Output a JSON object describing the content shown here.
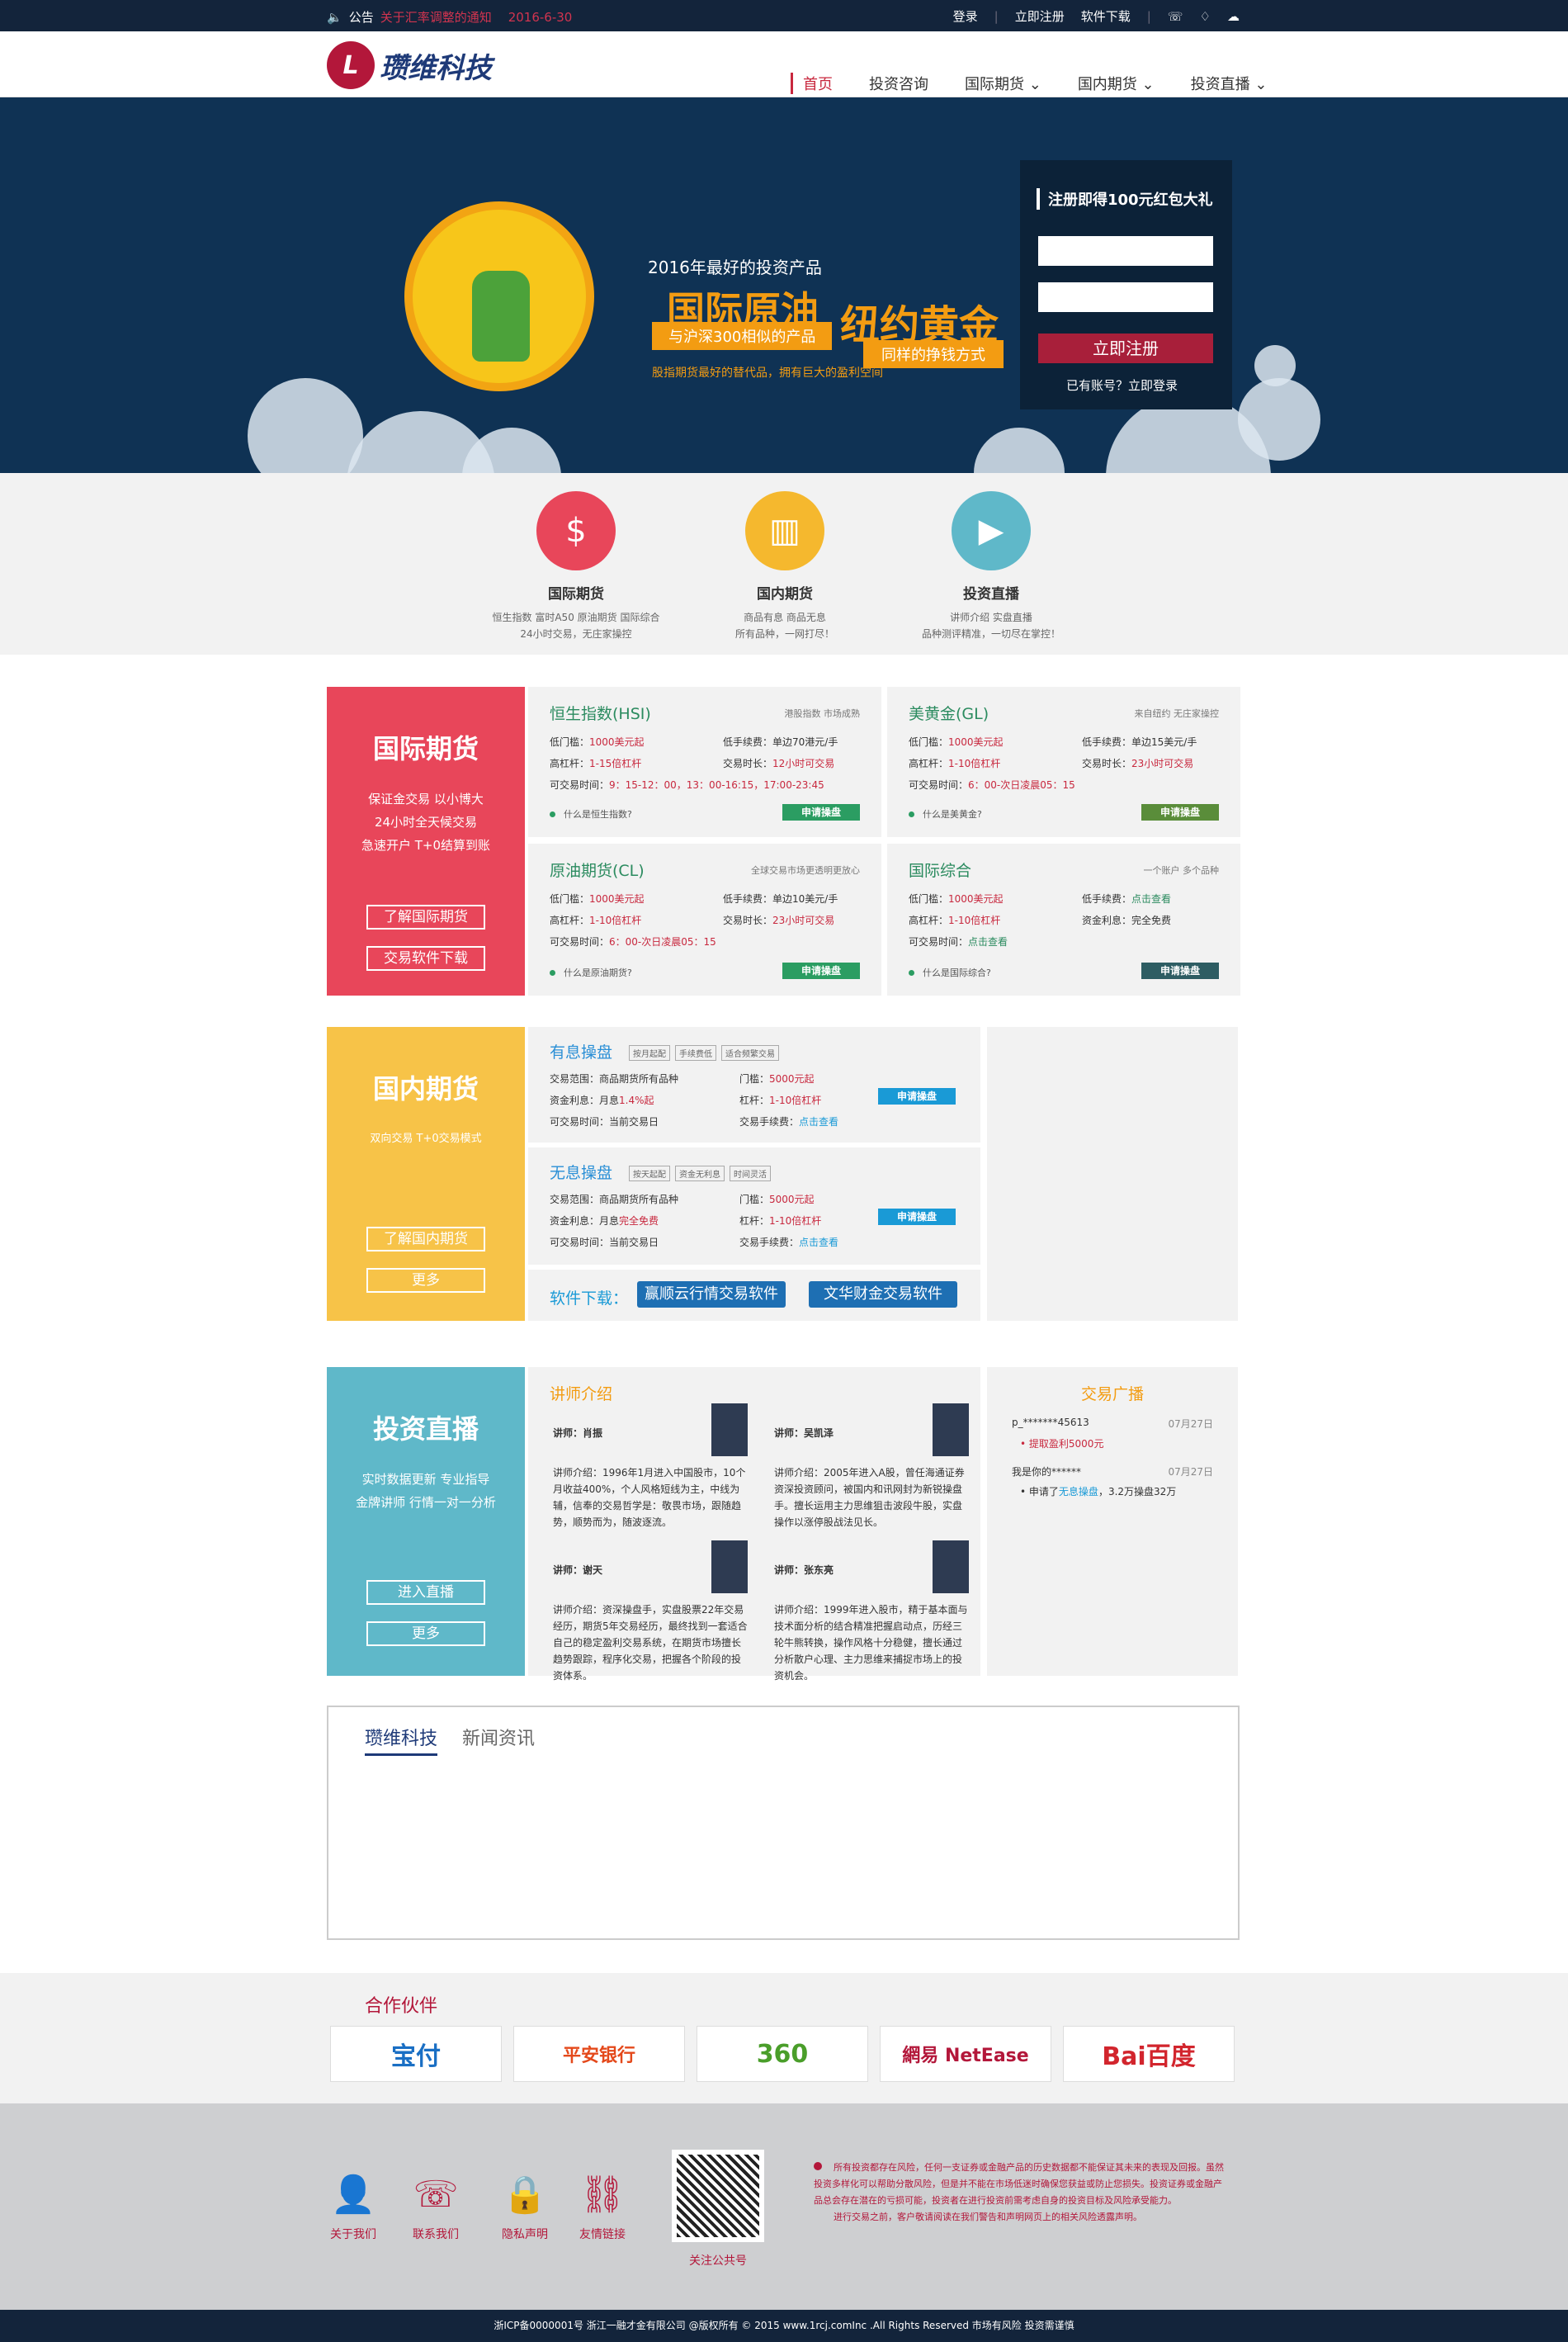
{
  "topbar": {
    "notice_label": "公告",
    "notice_text": "关于汇率调整的通知",
    "notice_date": "2016-6-30",
    "login": "登录",
    "register": "立即注册",
    "download": "软件下载"
  },
  "header": {
    "logo_mark": "L",
    "logo_name": "瓒维科技",
    "nav": [
      "首页",
      "投资咨询",
      "国际期货",
      "国内期货",
      "投资直播"
    ]
  },
  "banner": {
    "line1": "2016年最好的投资产品",
    "line2": "国际原油",
    "line3": "与沪深300相似的产品",
    "line4": "纽约黄金",
    "line5": "同样的挣钱方式",
    "line6": "股指期货最好的替代品，拥有巨大的盈利空间",
    "reg_title": "注册即得100元红包大礼",
    "reg_button": "立即注册",
    "reg_login": "已有账号？立即登录"
  },
  "features": [
    {
      "title": "国际期货",
      "desc1": "恒生指数 富时A50 原油期货 国际综合",
      "desc2": "24小时交易，无庄家操控",
      "color": "#e8465a"
    },
    {
      "title": "国内期货",
      "desc1": "商品有息 商品无息",
      "desc2": "所有品种，一网打尽！",
      "color": "#f5b82e"
    },
    {
      "title": "投资直播",
      "desc1": "讲师介绍 实盘直播",
      "desc2": "品种测评精准，一切尽在掌控！",
      "color": "#5fb8c9"
    }
  ],
  "intl": {
    "title": "国际期货",
    "desc": [
      "保证金交易  以小博大",
      "24小时全天候交易",
      "急速开户  T+0结算到账"
    ],
    "btn1": "了解国际期货",
    "btn2": "交易软件下载",
    "cards": [
      {
        "title": "恒生指数(HSI)",
        "sub": "港股指数 市场成熟",
        "r1a": "低门槛：",
        "r1b": "1000美元起",
        "r1c": "低手续费：",
        "r1d": "单边70港元/手",
        "r2a": "高杠杆：",
        "r2b": "1-15倍杠杆",
        "r2c": "交易时长：",
        "r2d": "12小时可交易",
        "r3a": "可交易时间：",
        "r3b": "9：15-12：00，13：00-16:15，17:00-23:45",
        "q": "什么是恒生指数?",
        "apply": "申请操盘"
      },
      {
        "title": "美黄金(GL)",
        "sub": "来自纽约 无庄家操控",
        "r1a": "低门槛：",
        "r1b": "1000美元起",
        "r1c": "低手续费：",
        "r1d": "单边15美元/手",
        "r2a": "高杠杆：",
        "r2b": "1-10倍杠杆",
        "r2c": "交易时长：",
        "r2d": "23小时可交易",
        "r3a": "可交易时间：",
        "r3b": "6：00-次日凌晨05：15",
        "q": "什么是美黄金?",
        "apply": "申请操盘"
      },
      {
        "title": "原油期货(CL)",
        "sub": "全球交易市场更透明更放心",
        "r1a": "低门槛：",
        "r1b": "1000美元起",
        "r1c": "低手续费：",
        "r1d": "单边10美元/手",
        "r2a": "高杠杆：",
        "r2b": "1-10倍杠杆",
        "r2c": "交易时长：",
        "r2d": "23小时可交易",
        "r3a": "可交易时间：",
        "r3b": "6：00-次日凌晨05：15",
        "q": "什么是原油期货?",
        "apply": "申请操盘"
      },
      {
        "title": "国际综合",
        "sub": "一个账户 多个品种",
        "r1a": "低门槛：",
        "r1b": "1000美元起",
        "r1c": "低手续费：",
        "r1d": "点击查看",
        "r2a": "高杠杆：",
        "r2b": "1-10倍杠杆",
        "r2c": "资金利息：",
        "r2d": "完全免费",
        "r3a": "可交易时间：",
        "r3b": "点击查看",
        "q": "什么是国际综合?",
        "apply": "申请操盘"
      }
    ]
  },
  "domestic": {
    "title": "国内期货",
    "desc": "双向交易 T+0交易模式",
    "btn1": "了解国内期货",
    "btn2": "更多",
    "cards": [
      {
        "title": "有息操盘",
        "tags": [
          "按月起配",
          "手续费低",
          "适合频繁交易"
        ],
        "a1": "交易范围：商品期货所有品种",
        "a2": "门槛：",
        "a2v": "5000元起",
        "b1": "资金利息：月息",
        "b1v": "1.4%起",
        "b2": "杠杆：",
        "b2v": "1-10倍杠杆",
        "c1": "可交易时间：当前交易日",
        "c2": "交易手续费：",
        "c2v": "点击查看",
        "apply": "申请操盘"
      },
      {
        "title": "无息操盘",
        "tags": [
          "按天起配",
          "资金无利息",
          "时间灵活"
        ],
        "a1": "交易范围：商品期货所有品种",
        "a2": "门槛：",
        "a2v": "5000元起",
        "b1": "资金利息：月息",
        "b1v": "完全免费",
        "b2": "杠杆：",
        "b2v": "1-10倍杠杆",
        "c1": "可交易时间：当前交易日",
        "c2": "交易手续费：",
        "c2v": "点击查看",
        "apply": "申请操盘"
      }
    ],
    "sw_label": "软件下载：",
    "sw1": "赢顺云行情交易软件",
    "sw2": "文华财金交易软件"
  },
  "live": {
    "title": "投资直播",
    "desc": [
      "实时数据更新  专业指导",
      "金牌讲师  行情一对一分析"
    ],
    "btn1": "进入直播",
    "btn2": "更多",
    "teachers_title": "讲师介绍",
    "teachers": [
      {
        "name": "讲师：肖振",
        "bio": "讲师介绍：1996年1月进入中国股市，10个月收益400%，个人风格短线为主，中线为辅，信奉的交易哲学是：敬畏市场，跟随趋势，顺势而为，随波逐流。"
      },
      {
        "name": "讲师：吴凯泽",
        "bio": "讲师介绍：2005年进入A股，曾任海通证券资深投资顾问，被国内和讯网封为新锐操盘手。擅长运用主力思维狙击波段牛股，实盘操作以涨停股战法见长。"
      },
      {
        "name": "讲师：谢天",
        "bio": "讲师介绍：资深操盘手，实盘股票22年交易经历，期货5年交易经历，最终找到一套适合自己的稳定盈利交易系统，在期货市场擅长趋势跟踪，程序化交易，把握各个阶段的投资体系。"
      },
      {
        "name": "讲师：张东亮",
        "bio": "讲师介绍：1999年进入股市，精于基本面与技术面分析的结合精准把握启动点，历经三轮牛熊转换，操作风格十分稳健，擅长通过分析散户心理、主力思维来捕捉市场上的投资机会。"
      }
    ],
    "bcast_title": "交易广播",
    "bcast": [
      {
        "user": "p_*******45613",
        "date": "07月27日",
        "text": "提取盈利5000元"
      },
      {
        "user": "我是你的******",
        "date": "07月27日",
        "text_a": "申请了",
        "text_b": "无息操盘",
        "text_c": "，3.2万操盘32万"
      }
    ]
  },
  "news": {
    "tab1": "瓒维科技",
    "tab2": "新闻资讯"
  },
  "partners": {
    "title": "合作伙伴",
    "logos": [
      "宝付",
      "平安银行",
      "360",
      "網易 NetEase",
      "Bai百度"
    ],
    "logo_colors": [
      "#1a6fc4",
      "#e4491b",
      "#4a9e2a",
      "#b3173a",
      "#d2252d"
    ]
  },
  "footer": {
    "items": [
      "关于我们",
      "联系我们",
      "隐私声明",
      "友情链接"
    ],
    "qr_label": "关注公共号",
    "disc1": "所有投资都存在风险，任何一支证券或金融产品的历史数据都不能保证其未来的表现及回报。虽然投资多样化可以帮助分散风险，但是并不能在市场低迷时确保您获益或防止您损失。投资证券或金融产品总会存在潜在的亏损可能，投资者在进行投资前需考虑自身的投资目标及风险承受能力。",
    "disc2": "进行交易之前，客户敬请阅读在我们警告和声明网页上的相关风险透露声明。",
    "copyright": "浙ICP备0000001号    浙江一融才金有限公司 @版权所有    © 2015 www.1rcj.comInc .All Rights Reserved 市场有风险 投资需谨慎"
  }
}
